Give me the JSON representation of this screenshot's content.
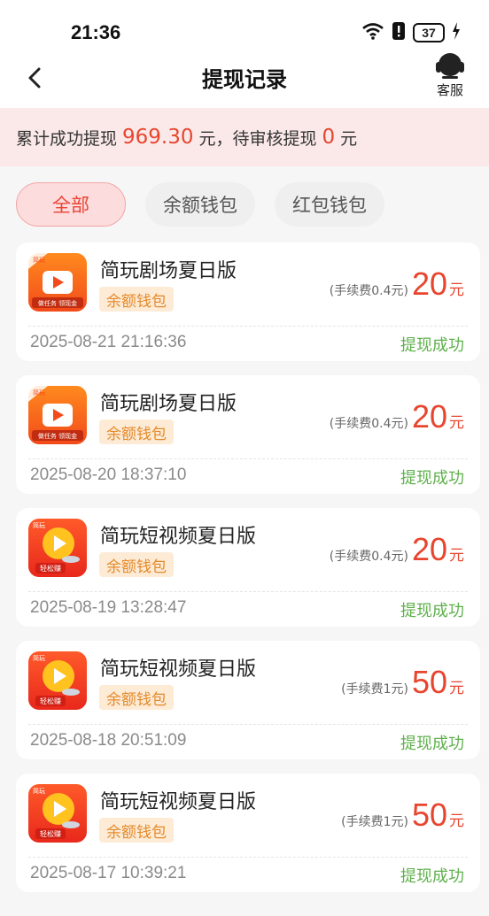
{
  "status_bar": {
    "time": "21:36",
    "battery": "37"
  },
  "header": {
    "title": "提现记录",
    "service_label": "客服"
  },
  "summary": {
    "prefix": "累计成功提现",
    "total": "969.30",
    "unit1": "元，待审核提现",
    "pending": "0",
    "unit2": "元"
  },
  "tabs": [
    {
      "label": "全部",
      "active": true
    },
    {
      "label": "余额钱包",
      "active": false
    },
    {
      "label": "红包钱包",
      "active": false
    }
  ],
  "records": [
    {
      "app": "简玩剧场夏日版",
      "icon": "theater-app-icon",
      "wallet": "余额钱包",
      "fee": "(手续费0.4元)",
      "amount": "20",
      "unit": "元",
      "datetime": "2025-08-21 21:16:36",
      "status": "提现成功"
    },
    {
      "app": "简玩剧场夏日版",
      "icon": "theater-app-icon",
      "wallet": "余额钱包",
      "fee": "(手续费0.4元)",
      "amount": "20",
      "unit": "元",
      "datetime": "2025-08-20 18:37:10",
      "status": "提现成功"
    },
    {
      "app": "简玩短视频夏日版",
      "icon": "video-app-icon",
      "wallet": "余额钱包",
      "fee": "(手续费0.4元)",
      "amount": "20",
      "unit": "元",
      "datetime": "2025-08-19 13:28:47",
      "status": "提现成功"
    },
    {
      "app": "简玩短视频夏日版",
      "icon": "video-app-icon",
      "wallet": "余额钱包",
      "fee": "(手续费1元)",
      "amount": "50",
      "unit": "元",
      "datetime": "2025-08-18 20:51:09",
      "status": "提现成功"
    },
    {
      "app": "简玩短视频夏日版",
      "icon": "video-app-icon",
      "wallet": "余额钱包",
      "fee": "(手续费1元)",
      "amount": "50",
      "unit": "元",
      "datetime": "2025-08-17 10:39:21",
      "status": "提现成功"
    }
  ],
  "app_icon_text": {
    "theater": {
      "corner": "简玩",
      "tagline": "做任务 领现金"
    },
    "video": {
      "corner": "简玩",
      "tagline": "轻松赚"
    }
  },
  "colors": {
    "accent": "#e8452e",
    "success": "#5fb04c",
    "badge": "#e48a2a"
  }
}
